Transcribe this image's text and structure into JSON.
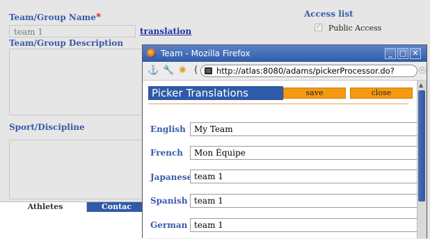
{
  "form": {
    "team_name_label": "Team/Group Name",
    "required_mark": "*",
    "team_name_value": "team 1",
    "translation_link": "translation",
    "description_label": "Team/Group Description",
    "sport_label": "Sport/Discipline",
    "access_list_label": "Access list",
    "public_access_label": "Public Access",
    "public_access_checked": true
  },
  "tabs": [
    {
      "label": "Athletes",
      "active": false
    },
    {
      "label": "Contac",
      "active": true
    }
  ],
  "popup": {
    "title": "Team - Mozilla Firefox",
    "url": "http://atlas:8080/adams/pickerProcessor.do?",
    "heading": "Picker Translations",
    "save_label": "save",
    "close_label": "close",
    "translations": [
      {
        "language": "English",
        "value": "My Team"
      },
      {
        "language": "French",
        "value": "Mon Équipe"
      },
      {
        "language": "Japanese",
        "value": "team 1"
      },
      {
        "language": "Spanish",
        "value": "team 1"
      },
      {
        "language": "German",
        "value": "team 1"
      }
    ]
  },
  "colors": {
    "label_blue": "#3a5aa8",
    "required_red": "#d62020",
    "picker_header": "#2e5aa8",
    "picker_button": "#f59a12"
  }
}
